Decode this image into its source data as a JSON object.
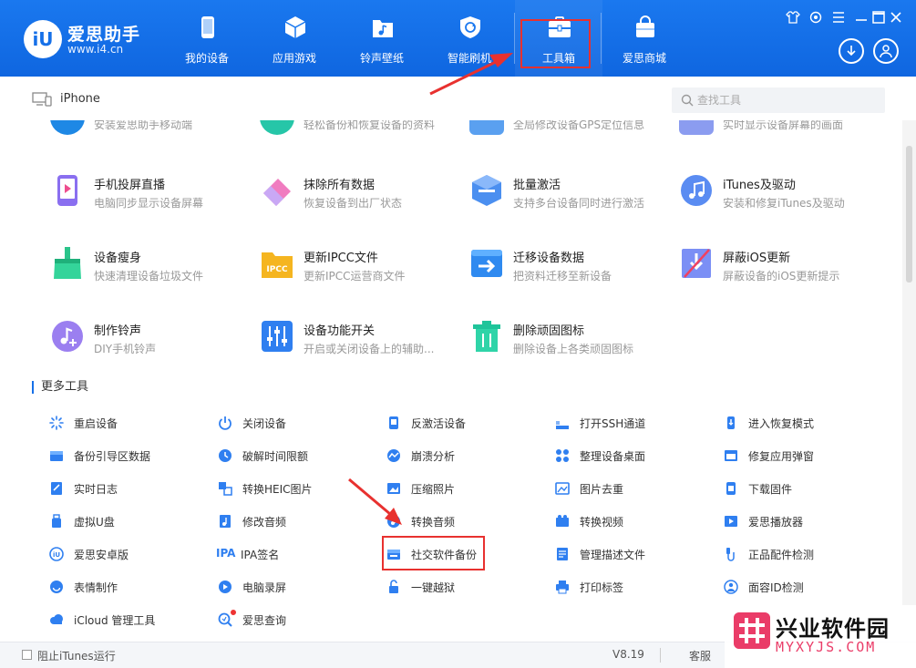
{
  "app": {
    "name": "爱思助手",
    "url": "www.i4.cn",
    "logo_mark": "iU"
  },
  "nav": {
    "tabs": [
      {
        "label": "我的设备",
        "icon": "phone-icon"
      },
      {
        "label": "应用游戏",
        "icon": "cube-icon"
      },
      {
        "label": "铃声壁纸",
        "icon": "music-folder-icon"
      },
      {
        "label": "智能刷机",
        "icon": "refresh-shield-icon"
      },
      {
        "label": "工具箱",
        "icon": "toolbox-icon",
        "active": true
      },
      {
        "label": "爱思商城",
        "icon": "shopping-bag-icon"
      }
    ]
  },
  "device": {
    "name": "iPhone"
  },
  "search": {
    "placeholder": "查找工具"
  },
  "partial_row": {
    "descs": [
      "安装爱思助手移动端",
      "轻松备份和恢复设备的资料",
      "全局修改设备GPS定位信息",
      "实时显示设备屏幕的画面"
    ]
  },
  "tools": [
    {
      "name": "手机投屏直播",
      "desc": "电脑同步显示设备屏幕",
      "icon": "screen-mirror-icon"
    },
    {
      "name": "抹除所有数据",
      "desc": "恢复设备到出厂状态",
      "icon": "eraser-icon"
    },
    {
      "name": "批量激活",
      "desc": "支持多台设备同时进行激活",
      "icon": "batch-activate-icon"
    },
    {
      "name": "iTunes及驱动",
      "desc": "安装和修复iTunes及驱动",
      "icon": "itunes-icon"
    },
    {
      "name": "设备瘦身",
      "desc": "快速清理设备垃圾文件",
      "icon": "broom-icon"
    },
    {
      "name": "更新IPCC文件",
      "desc": "更新IPCC运营商文件",
      "icon": "ipcc-folder-icon"
    },
    {
      "name": "迁移设备数据",
      "desc": "把资料迁移至新设备",
      "icon": "migrate-icon"
    },
    {
      "name": "屏蔽iOS更新",
      "desc": "屏蔽设备的iOS更新提示",
      "icon": "block-update-icon"
    },
    {
      "name": "制作铃声",
      "desc": "DIY手机铃声",
      "icon": "ringtone-icon"
    },
    {
      "name": "设备功能开关",
      "desc": "开启或关闭设备上的辅助...",
      "icon": "switch-sliders-icon"
    },
    {
      "name": "删除顽固图标",
      "desc": "删除设备上各类顽固图标",
      "icon": "trash-icon"
    }
  ],
  "more_tools": {
    "title": "更多工具",
    "items": [
      {
        "label": "重启设备",
        "icon": "restart-icon"
      },
      {
        "label": "关闭设备",
        "icon": "power-icon"
      },
      {
        "label": "反激活设备",
        "icon": "deactivate-icon"
      },
      {
        "label": "打开SSH通道",
        "icon": "ssh-icon"
      },
      {
        "label": "进入恢复模式",
        "icon": "recovery-mode-icon"
      },
      {
        "label": "备份引导区数据",
        "icon": "boot-backup-icon"
      },
      {
        "label": "破解时间限额",
        "icon": "clock-icon"
      },
      {
        "label": "崩溃分析",
        "icon": "crash-analysis-icon"
      },
      {
        "label": "整理设备桌面",
        "icon": "desktop-grid-icon"
      },
      {
        "label": "修复应用弹窗",
        "icon": "fix-popup-icon"
      },
      {
        "label": "实时日志",
        "icon": "log-icon"
      },
      {
        "label": "转换HEIC图片",
        "icon": "heic-convert-icon"
      },
      {
        "label": "压缩照片",
        "icon": "compress-photo-icon"
      },
      {
        "label": "图片去重",
        "icon": "dedupe-image-icon"
      },
      {
        "label": "下载固件",
        "icon": "download-firmware-icon"
      },
      {
        "label": "虚拟U盘",
        "icon": "usb-drive-icon"
      },
      {
        "label": "修改音频",
        "icon": "edit-audio-icon"
      },
      {
        "label": "转换音频",
        "icon": "convert-audio-icon"
      },
      {
        "label": "转换视频",
        "icon": "convert-video-icon"
      },
      {
        "label": "爱思播放器",
        "icon": "player-icon"
      },
      {
        "label": "爱思安卓版",
        "icon": "android-icon"
      },
      {
        "label": "IPA签名",
        "icon": "ipa-icon"
      },
      {
        "label": "社交软件备份",
        "icon": "social-backup-icon"
      },
      {
        "label": "管理描述文件",
        "icon": "profile-icon"
      },
      {
        "label": "正品配件检测",
        "icon": "accessory-check-icon"
      },
      {
        "label": "表情制作",
        "icon": "emoji-icon"
      },
      {
        "label": "电脑录屏",
        "icon": "screen-record-icon"
      },
      {
        "label": "一键越狱",
        "icon": "unlock-icon"
      },
      {
        "label": "打印标签",
        "icon": "printer-icon"
      },
      {
        "label": "面容ID检测",
        "icon": "face-id-icon"
      },
      {
        "label": "iCloud 管理工具",
        "icon": "cloud-icon"
      },
      {
        "label": "爱思查询",
        "icon": "query-icon"
      }
    ]
  },
  "footer": {
    "block_itunes_label": "阻止iTunes运行",
    "version": "V8.19",
    "support_label": "客服"
  },
  "watermark": {
    "title": "兴业软件园",
    "url": "MYXYJS.COM"
  },
  "colors": {
    "header_blue": "#1670e8",
    "highlight_red": "#e8312f"
  }
}
